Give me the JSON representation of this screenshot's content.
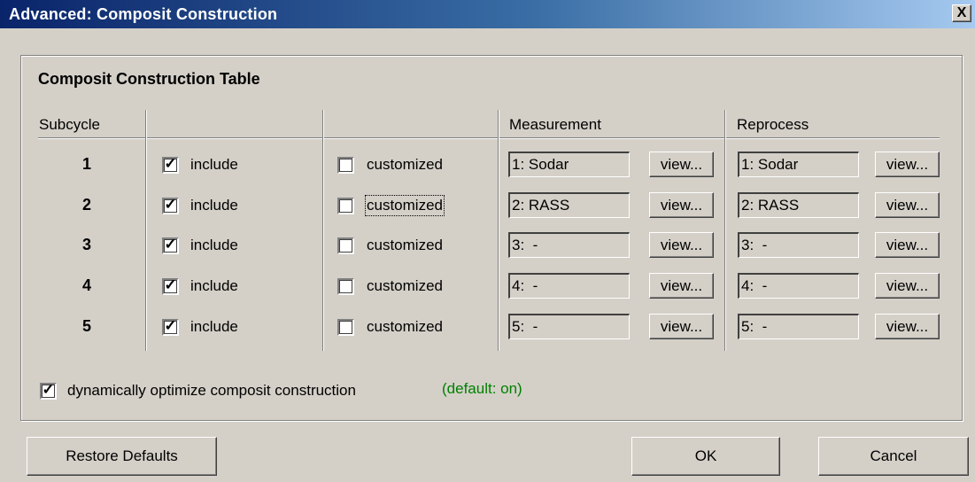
{
  "window": {
    "title": "Advanced: Composit Construction",
    "close_glyph": "X"
  },
  "group": {
    "title": "Composit Construction Table",
    "headers": {
      "subcycle": "Subcycle",
      "measurement": "Measurement",
      "reprocess": "Reprocess"
    }
  },
  "rows": [
    {
      "num": "1",
      "include_label": "include",
      "include_checked": true,
      "custom_label": "customized",
      "custom_checked": false,
      "measurement": "1: Sodar",
      "reprocess": "1: Sodar"
    },
    {
      "num": "2",
      "include_label": "include",
      "include_checked": true,
      "custom_label": "customized",
      "custom_checked": false,
      "measurement": "2: RASS",
      "reprocess": "2: RASS"
    },
    {
      "num": "3",
      "include_label": "include",
      "include_checked": true,
      "custom_label": "customized",
      "custom_checked": false,
      "measurement": "3:  -",
      "reprocess": "3:  -"
    },
    {
      "num": "4",
      "include_label": "include",
      "include_checked": true,
      "custom_label": "customized",
      "custom_checked": false,
      "measurement": "4:  -",
      "reprocess": "4:  -"
    },
    {
      "num": "5",
      "include_label": "include",
      "include_checked": true,
      "custom_label": "customized",
      "custom_checked": false,
      "measurement": "5:  -",
      "reprocess": "5:  -"
    }
  ],
  "view_label": "view...",
  "optimize": {
    "label": "dynamically optimize composit construction",
    "checked": true,
    "default_note": "(default: on)",
    "note_color": "#008000"
  },
  "buttons": {
    "restore": "Restore Defaults",
    "ok": "OK",
    "cancel": "Cancel"
  },
  "check_glyph": "✓"
}
